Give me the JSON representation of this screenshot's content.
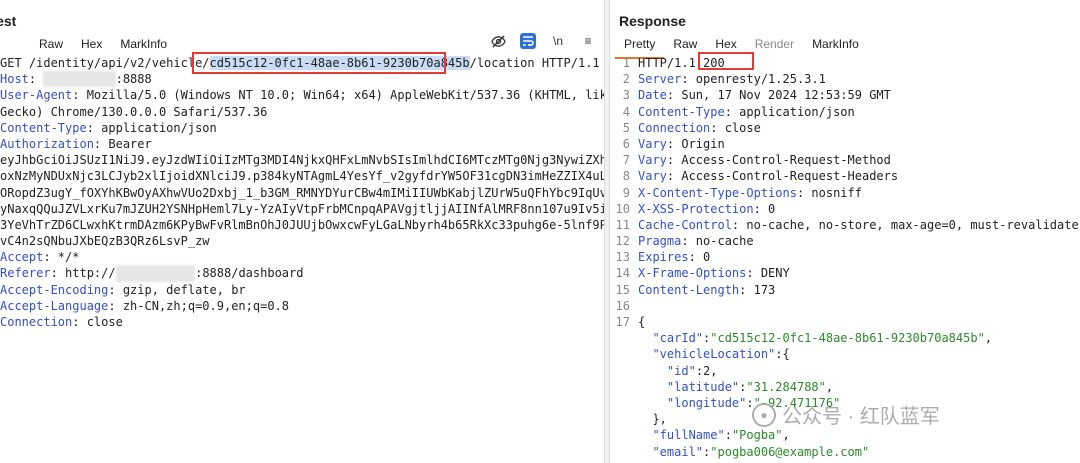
{
  "request": {
    "title": "quest",
    "tabs": [
      "Raw",
      "Hex",
      "MarkInfo"
    ],
    "toolbar": {
      "hide_icon": "eye-off-icon",
      "wrap_icon": "wrap-icon",
      "newline_label": "\\n",
      "menu_label": "≡"
    },
    "lines": {
      "l1_a": "GET /identity/api/v2/vehicle/",
      "l1_id": "cd515c12-0fc1-48ae-8b61-9230b70a845b",
      "l1_b": "/location HTTP/1.1",
      "host_key": "Host",
      "host_val_a": ": ",
      "host_redacted": "xxxxxxxxxx",
      "host_val_b": ":8888",
      "ua_key": "User-Agent",
      "ua_val": ": Mozilla/5.0 (Windows NT 10.0; Win64; x64) AppleWebKit/537.36 (KHTML, like",
      "ua_cont": "Gecko) Chrome/130.0.0.0 Safari/537.36",
      "ct_key": "Content-Type",
      "ct_val": ": application/json",
      "auth_key": "Authorization",
      "auth_val": ": Bearer",
      "tok1": "eyJhbGciOiJSUzI1NiJ9.eyJzdWIiOiIzMTg3MDI4NjkxQHFxLmNvbSIsImlhdCI6MTczMTg0Njg3NywiZXhwIj",
      "tok2": "oxNzMyNDUxNjc3LCJyb2xlIjoidXNlciJ9.p384kyNTAgmL4YesYf_v2gyfdrYW5OF31cgDN3imHeZZIX4uLuWU",
      "tok3": "ORopdZ3ugY_fOXYhKBwOyAXhwVUo2Dxbj_1_b3GM_RMNYDYurCBw4mIMiIIUWbKabjlZUrW5uQFhYbc9IqUvyPh",
      "tok4": "yNaxqQQuJZVLxrKu7mJZUH2YSNHpHeml7Ly-YzAIyVtpFrbMCnpqAPAVgjtljjAIINfAlMRF8nn107u9Iv5iEhS",
      "tok5": "3YeVhTrZD6CLwxhKtrmDAzm6KPyBwFvRlmBnOhJ0JUUjbOwxcwFyLGaLNbyrh4b65RkXc33puhg6e-5lnf9P1CH",
      "tok6": "vC4n2sQNbuJXbEQzB3QRz6LsvP_zw",
      "accept_key": "Accept",
      "accept_val": ": */*",
      "ref_key": "Referer",
      "ref_val_a": ": http://",
      "ref_redacted": "xxxxxxxxxxx",
      "ref_val_b": ":8888/dashboard",
      "ae_key": "Accept-Encoding",
      "ae_val": ": gzip, deflate, br",
      "al_key": "Accept-Language",
      "al_val": ": zh-CN,zh;q=0.9,en;q=0.8",
      "conn_key": "Connection",
      "conn_val": ": close"
    }
  },
  "response": {
    "title": "Response",
    "tabs": [
      "Pretty",
      "Raw",
      "Hex",
      "Render",
      "MarkInfo"
    ],
    "line_numbers": [
      "1",
      "2",
      "3",
      "4",
      "5",
      "6",
      "7",
      "8",
      "9",
      "10",
      "11",
      "12",
      "13",
      "14",
      "15",
      "16",
      "17"
    ],
    "lines": {
      "status_a": "HTTP/1.",
      "status_b": "1 200",
      "server_key": "Server",
      "server_val": ": openresty/1.25.3.1",
      "date_key": "Date",
      "date_val": ": Sun, 17 Nov 2024 12:53:59 GMT",
      "ct_key": "Content-Type",
      "ct_val": ": application/json",
      "conn_key": "Connection",
      "conn_val": ": close",
      "vary1_key": "Vary",
      "vary1_val": ": Origin",
      "vary2_key": "Vary",
      "vary2_val": ": Access-Control-Request-Method",
      "vary3_key": "Vary",
      "vary3_val": ": Access-Control-Request-Headers",
      "xcto_key": "X-Content-Type-Options",
      "xcto_val": ": nosniff",
      "xxss_key": "X-XSS-Protection",
      "xxss_val": ": 0",
      "cc_key": "Cache-Control",
      "cc_val": ": no-cache, no-store, max-age=0, must-revalidate",
      "pragma_key": "Pragma",
      "pragma_val": ": no-cache",
      "expires_key": "Expires",
      "expires_val": ": 0",
      "xfo_key": "X-Frame-Options",
      "xfo_val": ": DENY",
      "cl_key": "Content-Length",
      "cl_val": ": 173",
      "brace_open": "{",
      "carid_key": "\"carId\"",
      "carid_val": "\"cd515c12-0fc1-48ae-8b61-9230b70a845b\"",
      "vl_key": "\"vehicleLocation\"",
      "vl_open": ":{",
      "id_key": "\"id\"",
      "id_val": ":2,",
      "lat_key": "\"latitude\"",
      "lat_val": "\"31.284788\"",
      "lon_key": "\"longitude\"",
      "lon_val": "\"-92.471176\"",
      "vl_close": "},",
      "fn_key": "\"fullName\"",
      "fn_val": "\"Pogba\"",
      "email_key": "\"email\"",
      "email_val": "\"pogba006@example.com\""
    }
  },
  "watermark": {
    "text": "公众号 · 红队蓝军",
    "icon": "wechat-icon"
  },
  "colors": {
    "accent": "#e8732a",
    "header_key": "#3350c8",
    "json_string": "#2a8a2a",
    "highlight_box": "#e53935",
    "selection": "#c9dcf5"
  }
}
